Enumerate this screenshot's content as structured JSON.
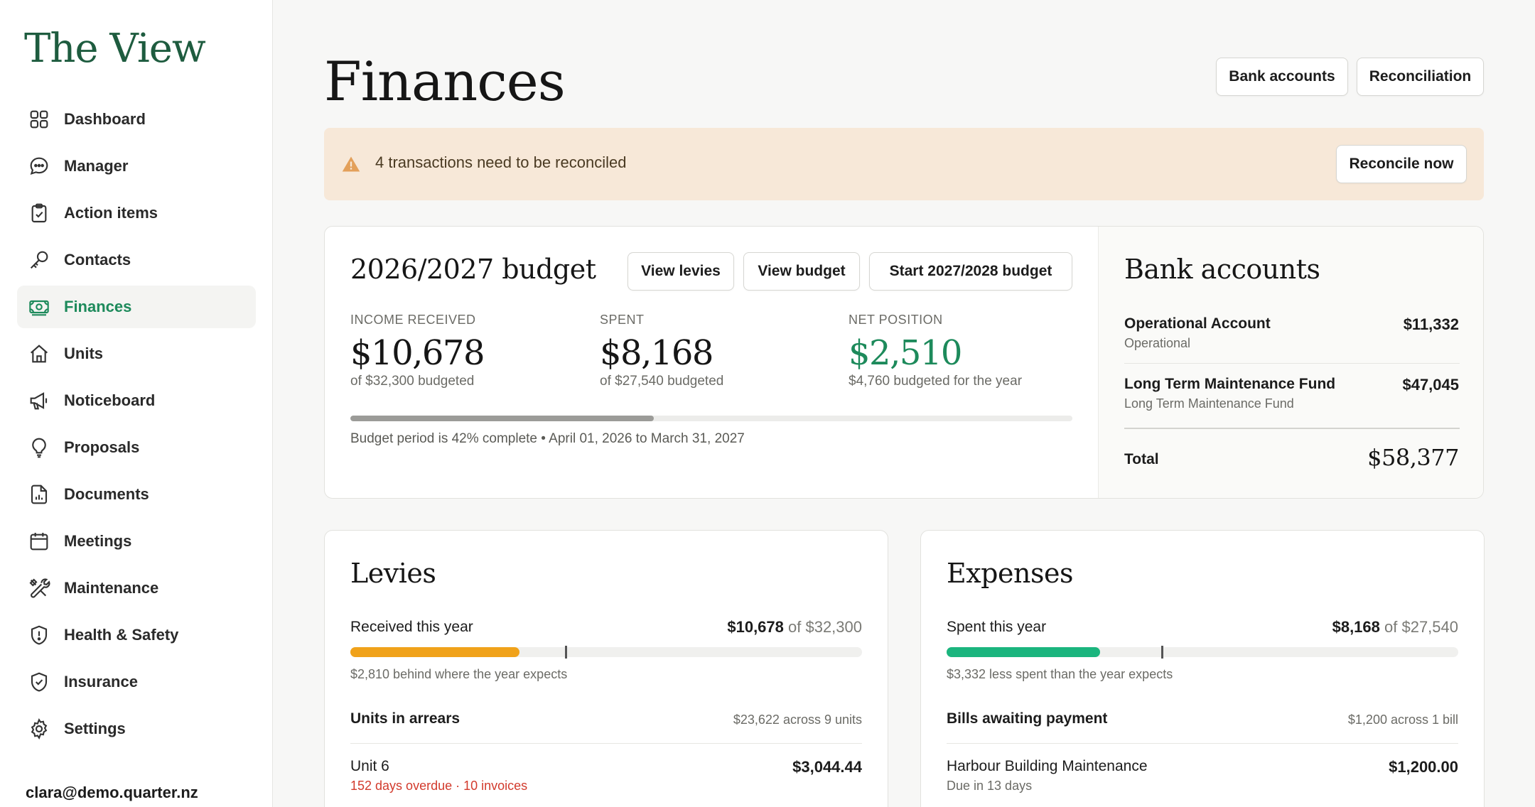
{
  "sidebar": {
    "brand": "The View",
    "items": [
      {
        "label": "Dashboard",
        "icon": "grid-icon"
      },
      {
        "label": "Manager",
        "icon": "chat-icon"
      },
      {
        "label": "Action items",
        "icon": "clipboard-check-icon"
      },
      {
        "label": "Contacts",
        "icon": "key-icon"
      },
      {
        "label": "Finances",
        "icon": "banknote-icon",
        "active": true
      },
      {
        "label": "Units",
        "icon": "home-icon"
      },
      {
        "label": "Noticeboard",
        "icon": "megaphone-icon"
      },
      {
        "label": "Proposals",
        "icon": "lightbulb-icon"
      },
      {
        "label": "Documents",
        "icon": "document-chart-icon"
      },
      {
        "label": "Meetings",
        "icon": "calendar-icon"
      },
      {
        "label": "Maintenance",
        "icon": "tools-icon"
      },
      {
        "label": "Health & Safety",
        "icon": "shield-alert-icon"
      },
      {
        "label": "Insurance",
        "icon": "shield-check-icon"
      },
      {
        "label": "Settings",
        "icon": "gear-icon"
      }
    ],
    "user_email": "clara@demo.quarter.nz"
  },
  "header": {
    "title": "Finances",
    "bank_accounts_label": "Bank accounts",
    "reconciliation_label": "Reconciliation"
  },
  "alert": {
    "message": "4 transactions need to be reconciled",
    "action_label": "Reconcile now",
    "color": "#f7e8d8"
  },
  "budget": {
    "title": "2026/2027 budget",
    "view_levies_label": "View levies",
    "view_budget_label": "View budget",
    "start_next_label": "Start 2027/2028 budget",
    "income": {
      "label": "INCOME RECEIVED",
      "value": "$10,678",
      "sub": "of $32,300 budgeted"
    },
    "spent": {
      "label": "SPENT",
      "value": "$8,168",
      "sub": "of $27,540 budgeted"
    },
    "net": {
      "label": "NET POSITION",
      "value": "$2,510",
      "sub": "$4,760 budgeted for the year",
      "color": "#1d8a5b"
    },
    "progress_percent": 42,
    "period_text": "Budget period is 42% complete • April 01, 2026 to March 31, 2027"
  },
  "bank_accounts": {
    "title": "Bank accounts",
    "accounts": [
      {
        "name": "Operational Account",
        "type": "Operational",
        "amount": "$11,332"
      },
      {
        "name": "Long Term Maintenance Fund",
        "type": "Long Term Maintenance Fund",
        "amount": "$47,045"
      }
    ],
    "total_label": "Total",
    "total_amount": "$58,377"
  },
  "levies": {
    "title": "Levies",
    "received_label": "Received this year",
    "received_amount": "$10,678",
    "received_of": "of $32,300",
    "progress_fraction": 0.33,
    "expected_fraction": 0.42,
    "bar_color": "#f0a21a",
    "note": "$2,810 behind where the year expects",
    "arrears_label": "Units in arrears",
    "arrears_summary": "$23,622 across 9 units",
    "items": [
      {
        "name": "Unit 6",
        "detail": "152 days overdue · 10 invoices",
        "amount": "$3,044.44"
      }
    ]
  },
  "expenses": {
    "title": "Expenses",
    "spent_label": "Spent this year",
    "spent_amount": "$8,168",
    "spent_of": "of $27,540",
    "progress_fraction": 0.3,
    "expected_fraction": 0.42,
    "bar_color": "#1bb57e",
    "note": "$3,332 less spent than the year expects",
    "bills_label": "Bills awaiting payment",
    "bills_summary": "$1,200 across 1 bill",
    "items": [
      {
        "name": "Harbour Building Maintenance",
        "detail": "Due in 13 days",
        "amount": "$1,200.00"
      }
    ]
  }
}
